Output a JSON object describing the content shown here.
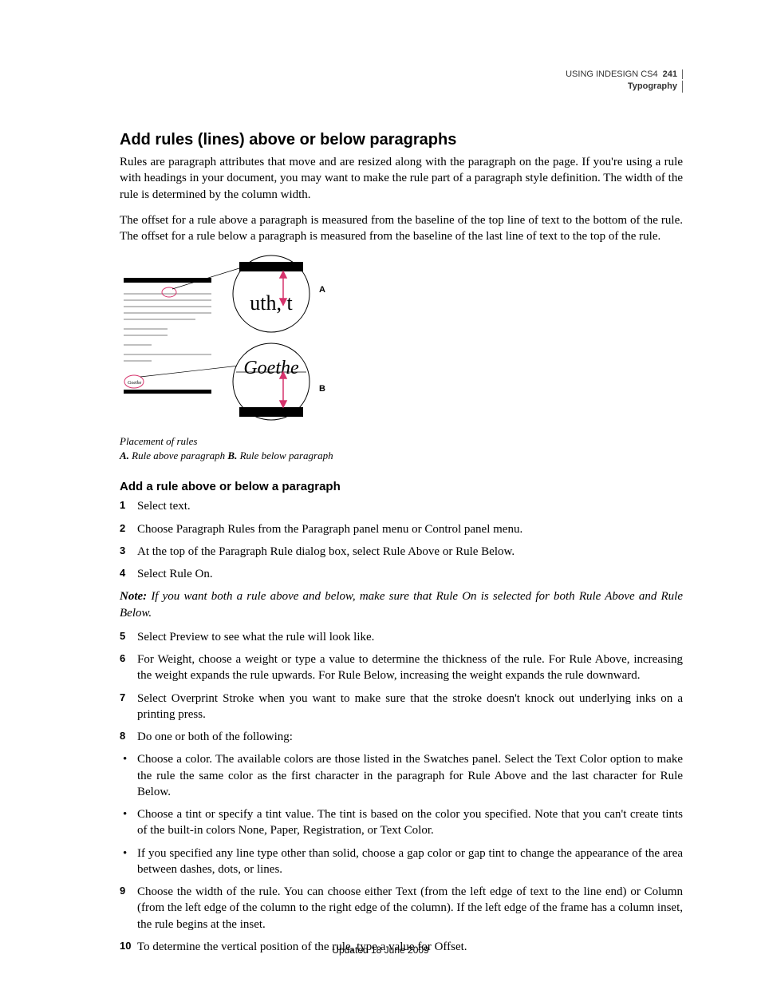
{
  "header": {
    "doc_title": "USING INDESIGN CS4",
    "section": "Typography",
    "page_number": "241"
  },
  "h1": "Add rules (lines) above or below paragraphs",
  "intro_p1": "Rules are paragraph attributes that move and are resized along with the paragraph on the page. If you're using a rule with headings in your document, you may want to make the rule part of a paragraph style definition. The width of the rule is determined by the column width.",
  "intro_p2": "The offset for a rule above a paragraph is measured from the baseline of the top line of text to the bottom of the rule. The offset for a rule below a paragraph is measured from the baseline of the last line of text to the top of the rule.",
  "figure": {
    "label_a": "A",
    "label_b": "B",
    "detail_top_text": "uth, t",
    "detail_bottom_text": "Goethe",
    "caption_title": "Placement of rules",
    "caption_a_label": "A.",
    "caption_a_text": " Rule above paragraph  ",
    "caption_b_label": "B.",
    "caption_b_text": " Rule below paragraph"
  },
  "h2": "Add a rule above or below a paragraph",
  "steps_1_4": [
    "Select text.",
    "Choose Paragraph Rules from the Paragraph panel menu or Control panel menu.",
    "At the top of the Paragraph Rule dialog box, select Rule Above or Rule Below.",
    "Select Rule On."
  ],
  "note": {
    "label": "Note:",
    "text": " If you want both a rule above and below, make sure that Rule On is selected for both Rule Above and Rule Below."
  },
  "steps_5_10": [
    "Select Preview to see what the rule will look like.",
    "For Weight, choose a weight or type a value to determine the thickness of the rule. For Rule Above, increasing the weight expands the rule upwards. For Rule Below, increasing the weight expands the rule downward.",
    "Select Overprint Stroke when you want to make sure that the stroke doesn't knock out underlying inks on a printing press.",
    "Do one or both of the following:"
  ],
  "bullets": [
    "Choose a color. The available colors are those listed in the Swatches panel. Select the Text Color option to make the rule the same color as the first character in the paragraph for Rule Above and the last character for Rule Below.",
    "Choose a tint or specify a tint value. The tint is based on the color you specified. Note that you can't create tints of the built-in colors None, Paper, Registration, or Text Color.",
    "If you specified any line type other than solid, choose a gap color or gap tint to change the appearance of the area between dashes, dots, or lines."
  ],
  "steps_9_10": [
    "Choose the width of the rule. You can choose either Text (from the left edge of text to the line end) or Column (from the left edge of the column to the right edge of the column). If the left edge of the frame has a column inset, the rule begins at the inset.",
    "To determine the vertical position of the rule, type a value for Offset."
  ],
  "footer": "Updated 18 June 2009"
}
